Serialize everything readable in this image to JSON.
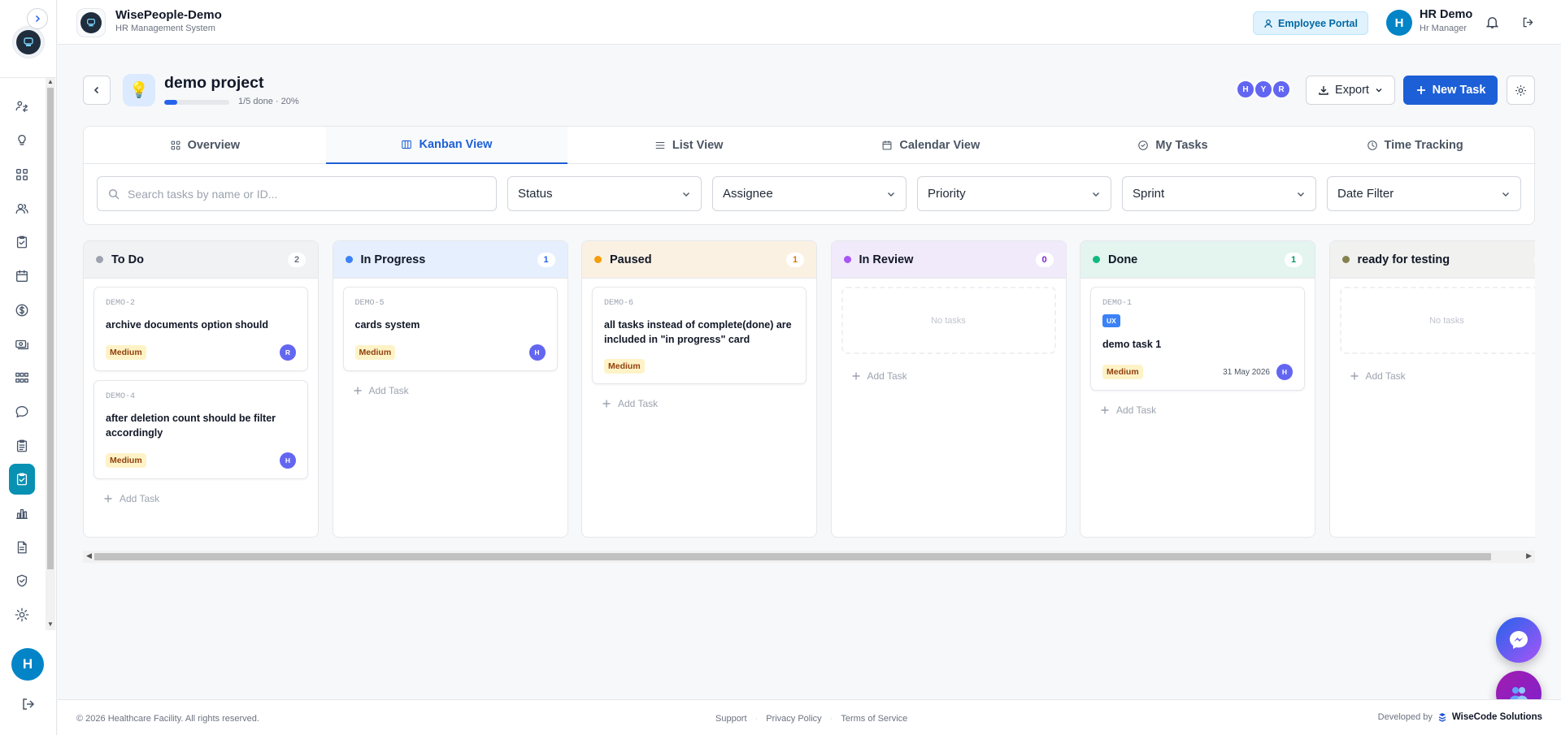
{
  "app": {
    "name": "WisePeople-Demo",
    "subtitle": "HR Management System"
  },
  "header": {
    "employee_portal": "Employee Portal",
    "user_initial": "H",
    "user_name": "HR Demo",
    "user_role": "Hr Manager"
  },
  "sidebar": {
    "items": [
      {
        "icon": "users-switch-icon"
      },
      {
        "icon": "lightbulb-icon"
      },
      {
        "icon": "grid-icon"
      },
      {
        "icon": "users-icon"
      },
      {
        "icon": "clipboard-check-icon"
      },
      {
        "icon": "calendar-icon"
      },
      {
        "icon": "dollar-icon"
      },
      {
        "icon": "cash-icon"
      },
      {
        "icon": "org-icon"
      },
      {
        "icon": "chat-icon"
      },
      {
        "icon": "clipboard-icon"
      },
      {
        "icon": "tasks-icon",
        "active": true
      },
      {
        "icon": "bar-chart-icon"
      },
      {
        "icon": "document-icon"
      },
      {
        "icon": "shield-icon"
      },
      {
        "icon": "gear-icon"
      }
    ],
    "avatar_initial": "H"
  },
  "project": {
    "title": "demo project",
    "icon": "💡",
    "progress_text": "1/5 done · 20%",
    "progress": 0.2,
    "team": [
      "H",
      "Y",
      "R"
    ],
    "export_label": "Export",
    "new_task_label": "New Task"
  },
  "tabs": [
    {
      "label": "Overview",
      "icon": "grid-icon"
    },
    {
      "label": "Kanban View",
      "icon": "columns-icon",
      "active": true
    },
    {
      "label": "List View",
      "icon": "list-icon"
    },
    {
      "label": "Calendar View",
      "icon": "calendar-icon"
    },
    {
      "label": "My Tasks",
      "icon": "check-circle-icon"
    },
    {
      "label": "Time Tracking",
      "icon": "clock-icon"
    }
  ],
  "filters": {
    "search_placeholder": "Search tasks by name or ID...",
    "status": "Status",
    "assignee": "Assignee",
    "priority": "Priority",
    "sprint": "Sprint",
    "date": "Date Filter"
  },
  "columns": [
    {
      "title": "To Do",
      "count": "2",
      "color": "#9ca3af",
      "head_bg": "#f1f2f4",
      "count_color": "#6b7280",
      "cards": [
        {
          "id": "DEMO-2",
          "title": "archive documents option should",
          "priority": "Medium",
          "assignee": "R"
        },
        {
          "id": "DEMO-4",
          "title": "after deletion count should be filter accordingly",
          "priority": "Medium",
          "assignee": "H"
        }
      ]
    },
    {
      "title": "In Progress",
      "count": "1",
      "color": "#3b82f6",
      "head_bg": "#e6effd",
      "count_color": "#2563eb",
      "cards": [
        {
          "id": "DEMO-5",
          "title": "cards system",
          "priority": "Medium",
          "assignee": "H"
        }
      ]
    },
    {
      "title": "Paused",
      "count": "1",
      "color": "#f59e0b",
      "head_bg": "#fbf1e2",
      "count_color": "#d97706",
      "cards": [
        {
          "id": "DEMO-6",
          "title": "all tasks instead of complete(done) are included in \"in progress\" card",
          "priority": "Medium"
        }
      ]
    },
    {
      "title": "In Review",
      "count": "0",
      "color": "#a855f7",
      "head_bg": "#f1eafb",
      "count_color": "#7e22ce",
      "cards": [],
      "empty": "No tasks"
    },
    {
      "title": "Done",
      "count": "1",
      "color": "#10b981",
      "head_bg": "#e3f5ee",
      "count_color": "#059669",
      "cards": [
        {
          "id": "DEMO-1",
          "tag": "UX",
          "title": "demo task 1",
          "priority": "Medium",
          "date": "31 May 2026",
          "assignee": "H"
        }
      ]
    },
    {
      "title": "ready for testing",
      "count": "",
      "color": "#84804f",
      "head_bg": "#f1f1ef",
      "count_color": "#6b7280",
      "cards": [],
      "empty": "No tasks"
    }
  ],
  "add_task_label": "Add Task",
  "footer": {
    "copyright": "© 2026 Healthcare Facility. All rights reserved.",
    "links": [
      "Support",
      "Privacy Policy",
      "Terms of Service"
    ],
    "developed_by": "Developed by",
    "company": "WiseCode Solutions"
  }
}
